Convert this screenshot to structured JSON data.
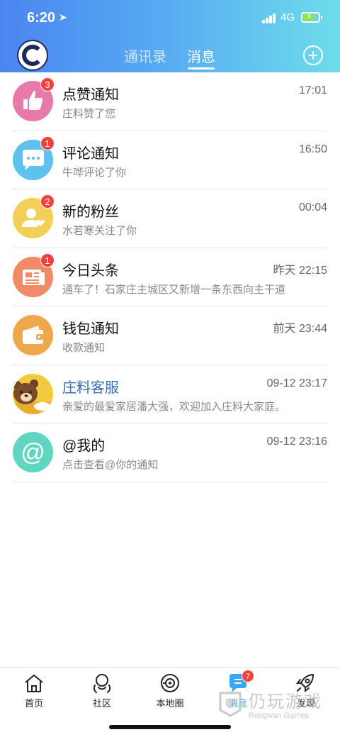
{
  "status_bar": {
    "time": "6:20",
    "network": "4G"
  },
  "header": {
    "tabs": [
      {
        "label": "通讯录"
      },
      {
        "label": "消息"
      }
    ]
  },
  "messages": [
    {
      "title": "点赞通知",
      "time": "17:01",
      "subtitle": "庄料赞了您",
      "badge": "3",
      "avatar_icon": "thumbs-up-icon",
      "color": "#e87aa8"
    },
    {
      "title": "评论通知",
      "time": "16:50",
      "subtitle": "牛哗评论了你",
      "badge": "1",
      "avatar_icon": "chat-bubble-icon",
      "color": "#5ec1ee"
    },
    {
      "title": "新的粉丝",
      "time": "00:04",
      "subtitle": "水若寒关注了你",
      "badge": "2",
      "avatar_icon": "follower-icon",
      "color": "#f3cf57"
    },
    {
      "title": "今日头条",
      "time": "昨天 22:15",
      "subtitle": "通车了！石家庄主城区又新增一条东西向主干道",
      "badge": "1",
      "avatar_icon": "newspaper-icon",
      "color": "#f18a67"
    },
    {
      "title": "钱包通知",
      "time": "前天 23:44",
      "subtitle": "收款通知",
      "badge": "",
      "avatar_icon": "wallet-icon",
      "color": "#eea74a"
    },
    {
      "title": "庄料客服",
      "time": "09-12 23:17",
      "subtitle": "亲爱的最爱家居潘大强，欢迎加入庄料大家庭。",
      "badge": "",
      "avatar_icon": "bear-avatar-icon",
      "color": "#f4c93e"
    },
    {
      "title": "@我的",
      "time": "09-12 23:16",
      "subtitle": "点击查看@你的通知",
      "badge": "",
      "avatar_icon": "at-sign-icon",
      "color": "#5fd5c2"
    }
  ],
  "tabbar": {
    "items": [
      {
        "label": "首页",
        "icon": "home-icon"
      },
      {
        "label": "社区",
        "icon": "community-icon"
      },
      {
        "label": "本地圈",
        "icon": "local-circle-icon"
      },
      {
        "label": "消息",
        "icon": "message-icon"
      },
      {
        "label": "发现",
        "icon": "rocket-icon"
      }
    ],
    "message_badge": "7"
  },
  "watermark": {
    "title": "仍玩游戏",
    "subtitle": "Rengwan Games"
  },
  "colors": {
    "accent": "#3aa5f1",
    "badge": "#f2413a",
    "header_start": "#4a86f0",
    "header_end": "#6fdceb"
  }
}
